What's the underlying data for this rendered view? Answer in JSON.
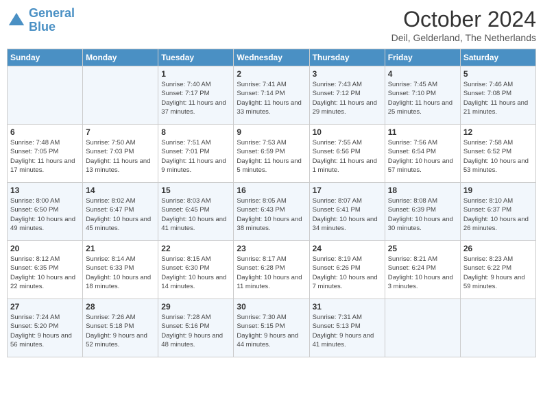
{
  "header": {
    "logo_line1": "General",
    "logo_line2": "Blue",
    "month_title": "October 2024",
    "location": "Deil, Gelderland, The Netherlands"
  },
  "days_of_week": [
    "Sunday",
    "Monday",
    "Tuesday",
    "Wednesday",
    "Thursday",
    "Friday",
    "Saturday"
  ],
  "weeks": [
    [
      {
        "day": "",
        "info": ""
      },
      {
        "day": "",
        "info": ""
      },
      {
        "day": "1",
        "info": "Sunrise: 7:40 AM\nSunset: 7:17 PM\nDaylight: 11 hours and 37 minutes."
      },
      {
        "day": "2",
        "info": "Sunrise: 7:41 AM\nSunset: 7:14 PM\nDaylight: 11 hours and 33 minutes."
      },
      {
        "day": "3",
        "info": "Sunrise: 7:43 AM\nSunset: 7:12 PM\nDaylight: 11 hours and 29 minutes."
      },
      {
        "day": "4",
        "info": "Sunrise: 7:45 AM\nSunset: 7:10 PM\nDaylight: 11 hours and 25 minutes."
      },
      {
        "day": "5",
        "info": "Sunrise: 7:46 AM\nSunset: 7:08 PM\nDaylight: 11 hours and 21 minutes."
      }
    ],
    [
      {
        "day": "6",
        "info": "Sunrise: 7:48 AM\nSunset: 7:05 PM\nDaylight: 11 hours and 17 minutes."
      },
      {
        "day": "7",
        "info": "Sunrise: 7:50 AM\nSunset: 7:03 PM\nDaylight: 11 hours and 13 minutes."
      },
      {
        "day": "8",
        "info": "Sunrise: 7:51 AM\nSunset: 7:01 PM\nDaylight: 11 hours and 9 minutes."
      },
      {
        "day": "9",
        "info": "Sunrise: 7:53 AM\nSunset: 6:59 PM\nDaylight: 11 hours and 5 minutes."
      },
      {
        "day": "10",
        "info": "Sunrise: 7:55 AM\nSunset: 6:56 PM\nDaylight: 11 hours and 1 minute."
      },
      {
        "day": "11",
        "info": "Sunrise: 7:56 AM\nSunset: 6:54 PM\nDaylight: 10 hours and 57 minutes."
      },
      {
        "day": "12",
        "info": "Sunrise: 7:58 AM\nSunset: 6:52 PM\nDaylight: 10 hours and 53 minutes."
      }
    ],
    [
      {
        "day": "13",
        "info": "Sunrise: 8:00 AM\nSunset: 6:50 PM\nDaylight: 10 hours and 49 minutes."
      },
      {
        "day": "14",
        "info": "Sunrise: 8:02 AM\nSunset: 6:47 PM\nDaylight: 10 hours and 45 minutes."
      },
      {
        "day": "15",
        "info": "Sunrise: 8:03 AM\nSunset: 6:45 PM\nDaylight: 10 hours and 41 minutes."
      },
      {
        "day": "16",
        "info": "Sunrise: 8:05 AM\nSunset: 6:43 PM\nDaylight: 10 hours and 38 minutes."
      },
      {
        "day": "17",
        "info": "Sunrise: 8:07 AM\nSunset: 6:41 PM\nDaylight: 10 hours and 34 minutes."
      },
      {
        "day": "18",
        "info": "Sunrise: 8:08 AM\nSunset: 6:39 PM\nDaylight: 10 hours and 30 minutes."
      },
      {
        "day": "19",
        "info": "Sunrise: 8:10 AM\nSunset: 6:37 PM\nDaylight: 10 hours and 26 minutes."
      }
    ],
    [
      {
        "day": "20",
        "info": "Sunrise: 8:12 AM\nSunset: 6:35 PM\nDaylight: 10 hours and 22 minutes."
      },
      {
        "day": "21",
        "info": "Sunrise: 8:14 AM\nSunset: 6:33 PM\nDaylight: 10 hours and 18 minutes."
      },
      {
        "day": "22",
        "info": "Sunrise: 8:15 AM\nSunset: 6:30 PM\nDaylight: 10 hours and 14 minutes."
      },
      {
        "day": "23",
        "info": "Sunrise: 8:17 AM\nSunset: 6:28 PM\nDaylight: 10 hours and 11 minutes."
      },
      {
        "day": "24",
        "info": "Sunrise: 8:19 AM\nSunset: 6:26 PM\nDaylight: 10 hours and 7 minutes."
      },
      {
        "day": "25",
        "info": "Sunrise: 8:21 AM\nSunset: 6:24 PM\nDaylight: 10 hours and 3 minutes."
      },
      {
        "day": "26",
        "info": "Sunrise: 8:23 AM\nSunset: 6:22 PM\nDaylight: 9 hours and 59 minutes."
      }
    ],
    [
      {
        "day": "27",
        "info": "Sunrise: 7:24 AM\nSunset: 5:20 PM\nDaylight: 9 hours and 56 minutes."
      },
      {
        "day": "28",
        "info": "Sunrise: 7:26 AM\nSunset: 5:18 PM\nDaylight: 9 hours and 52 minutes."
      },
      {
        "day": "29",
        "info": "Sunrise: 7:28 AM\nSunset: 5:16 PM\nDaylight: 9 hours and 48 minutes."
      },
      {
        "day": "30",
        "info": "Sunrise: 7:30 AM\nSunset: 5:15 PM\nDaylight: 9 hours and 44 minutes."
      },
      {
        "day": "31",
        "info": "Sunrise: 7:31 AM\nSunset: 5:13 PM\nDaylight: 9 hours and 41 minutes."
      },
      {
        "day": "",
        "info": ""
      },
      {
        "day": "",
        "info": ""
      }
    ]
  ]
}
